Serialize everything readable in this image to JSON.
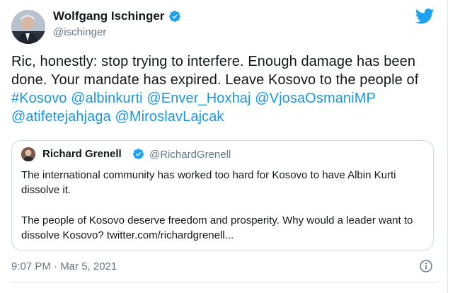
{
  "tweet": {
    "author": {
      "name": "Wolfgang Ischinger",
      "handle": "@ischinger"
    },
    "text_plain": "Ric, honestly: stop trying to interfere. Enough damage has been done. Your mandate has expired. Leave Kosovo to the people of ",
    "mentions": [
      {
        "text": "#Kosovo"
      },
      {
        "text": "@albinkurti"
      },
      {
        "text": "@Enver_Hoxhaj"
      },
      {
        "text": "@VjosaOsmaniMP"
      },
      {
        "text": "@atifetejahjaga"
      },
      {
        "text": "@MiroslavLajcak"
      }
    ],
    "timestamp": "9:07 PM · Mar 5, 2021"
  },
  "quoted": {
    "author": {
      "name": "Richard Grenell",
      "handle": "@RichardGrenell"
    },
    "paragraphs": [
      "The international community has worked too hard for Kosovo to have Albin Kurti dissolve it.",
      "The people of Kosovo deserve freedom and prosperity. Why would a leader want to dissolve Kosovo? twitter.com/richardgrenell..."
    ]
  },
  "icons": {
    "verified": "verified-badge-icon",
    "brand": "twitter-bird-icon",
    "info": "info-icon"
  },
  "colors": {
    "link": "#1b95e0",
    "brand": "#1da1f2",
    "secondary_text": "#657786",
    "border": "#cfd9de"
  }
}
